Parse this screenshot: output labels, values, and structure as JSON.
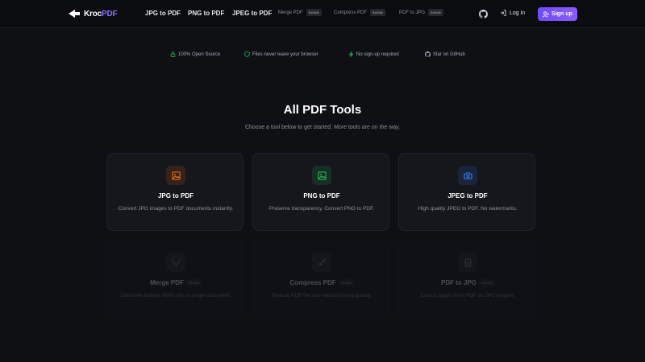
{
  "header": {
    "logo_text_a": "Kroc",
    "logo_text_b": "PDF",
    "nav": [
      "JPG to PDF",
      "PNG to PDF",
      "JPEG to PDF"
    ],
    "nav_soon": [
      {
        "label": "Merge PDF",
        "badge": "SOON"
      },
      {
        "label": "Compress PDF",
        "badge": "SOON"
      },
      {
        "label": "PDF to JPG",
        "badge": "SOON"
      }
    ],
    "github_icon": "github-icon",
    "login_label": "Log in",
    "signup_label": "Sign up"
  },
  "features": [
    {
      "icon": "lock-icon",
      "label": "100% Open Source"
    },
    {
      "icon": "shield-icon",
      "label": "Files never leave your browser"
    },
    {
      "icon": "bolt-icon",
      "label": "No sign-up required"
    },
    {
      "icon": "github-icon",
      "label": "Star on GitHub"
    }
  ],
  "main": {
    "title": "All PDF Tools",
    "subtitle": "Choose a tool below to get started. More tools are on the way."
  },
  "tools": [
    {
      "title": "JPG to PDF",
      "desc": "Convert JPG images to PDF documents instantly.",
      "icon": "image-icon",
      "color": "#f97316"
    },
    {
      "title": "PNG to PDF",
      "desc": "Preserve transparency. Convert PNG to PDF.",
      "icon": "image-icon",
      "color": "#22c55e"
    },
    {
      "title": "JPEG to PDF",
      "desc": "High quality JPEG to PDF. No watermarks.",
      "icon": "camera-icon",
      "color": "#3b82f6"
    },
    {
      "title": "Merge PDF",
      "badge": "SOON",
      "desc": "Combine multiple PDFs into a single document.",
      "icon": "merge-icon",
      "color": "#8a8f99"
    },
    {
      "title": "Compress PDF",
      "badge": "SOON",
      "desc": "Reduce PDF file size without losing quality.",
      "icon": "compress-icon",
      "color": "#8a8f99"
    },
    {
      "title": "PDF to JPG",
      "badge": "SOON",
      "desc": "Extract pages from PDF as JPG images.",
      "icon": "file-icon",
      "color": "#8a8f99"
    }
  ],
  "colors": {
    "accent": "#7c5cff",
    "background": "#0e1014",
    "card": "#15171c"
  }
}
